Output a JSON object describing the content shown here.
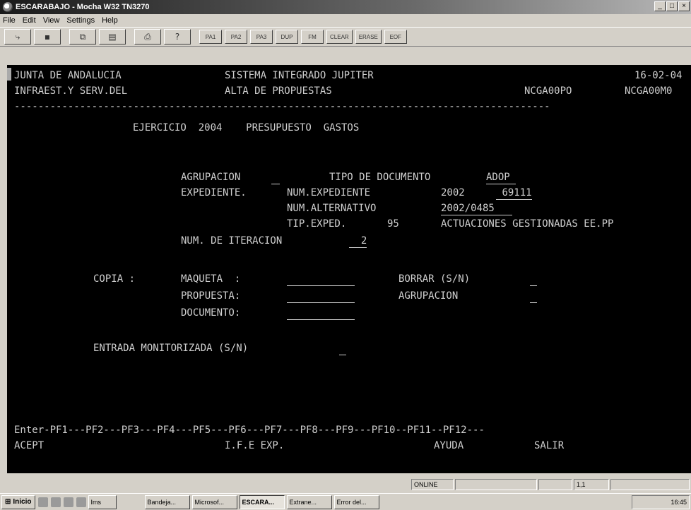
{
  "window": {
    "title": "ESCARABAJO - Mocha W32 TN3270",
    "min": "_",
    "max": "□",
    "close": "×"
  },
  "menu": [
    "File",
    "Edit",
    "View",
    "Settings",
    "Help"
  ],
  "toolbar": {
    "pf": [
      "PA1",
      "PA2",
      "PA3",
      "DUP",
      "FM",
      "CLEAR",
      "ERASE",
      "EOF"
    ]
  },
  "terminal": {
    "line1": {
      "left": "JUNTA DE ANDALUCIA",
      "mid": "SISTEMA INTEGRADO JUPITER",
      "right": "16-02-04"
    },
    "line2": {
      "left": "INFRAEST.Y SERV.DEL",
      "mid": "ALTA DE PROPUESTAS",
      "code1": "NCGA00PO",
      "code2": "NCGA00M0"
    },
    "separator": "------------------------------------------------------------------------------------------",
    "ejercicio": "EJERCICIO  2004    PRESUPUESTO  GASTOS",
    "agrupacion_label": "AGRUPACION",
    "tipo_doc_label": "TIPO DE DOCUMENTO",
    "tipo_doc_value": "ADOP",
    "expediente_label": "EXPEDIENTE.",
    "num_exp_label": "NUM.EXPEDIENTE",
    "num_exp_year": "2002",
    "num_exp_value": "69111",
    "num_alt_label": "NUM.ALTERNATIVO",
    "num_alt_value": "2002/0485",
    "tip_exp_label": "TIP.EXPED.",
    "tip_exp_value": "95",
    "tip_exp_desc": "ACTUACIONES GESTIONADAS EE.PP",
    "iteracion_label": "NUM. DE ITERACION",
    "iteracion_value": "2",
    "copia_label": "COPIA :",
    "maqueta_label": "MAQUETA  :",
    "propuesta_label": "PROPUESTA:",
    "documento_label": "DOCUMENTO:",
    "borrar_label": "BORRAR (S/N)",
    "agrupacion2_label": "AGRUPACION",
    "entrada_label": "ENTRADA MONITORIZADA (S/N)",
    "pf_line": "Enter-PF1---PF2---PF3---PF4---PF5---PF6---PF7---PF8---PF9---PF10--PF11--PF12---",
    "acept": "ACEPT",
    "ife": "I.F.E EXP.",
    "ayuda": "AYUDA",
    "salir": "SALIR"
  },
  "status": {
    "mode": "ONLINE",
    "pos": "1,1"
  },
  "taskbar": {
    "start": "Inicio",
    "items": [
      "Ims",
      "Bandeja...",
      "Microsof...",
      "ESCARA...",
      "Extrane...",
      "Error del..."
    ],
    "clock": "16:45"
  }
}
